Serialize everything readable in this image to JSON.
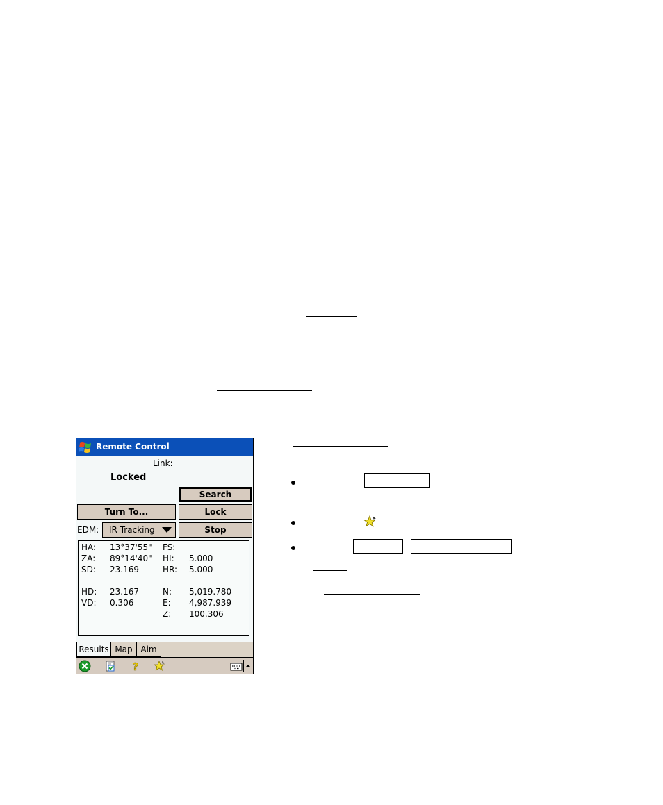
{
  "screen": {
    "title": "Remote Control",
    "link_label": "Link:",
    "status": "Locked",
    "buttons": {
      "search": "Search",
      "turn_to": "Turn To...",
      "lock": "Lock",
      "stop": "Stop"
    },
    "edm": {
      "label": "EDM:",
      "value": "IR Tracking"
    },
    "results": {
      "ha": {
        "label": "HA:",
        "value": "13°37'55\""
      },
      "za": {
        "label": "ZA:",
        "value": "89°14'40\""
      },
      "sd": {
        "label": "SD:",
        "value": "23.169"
      },
      "hd": {
        "label": "HD:",
        "value": "23.167"
      },
      "vd": {
        "label": "VD:",
        "value": "0.306"
      },
      "fs": {
        "label": "FS:",
        "value": ""
      },
      "hi": {
        "label": "HI:",
        "value": "5.000"
      },
      "hr": {
        "label": "HR:",
        "value": "5.000"
      },
      "n": {
        "label": "N:",
        "value": "5,019.780"
      },
      "e": {
        "label": "E:",
        "value": "4,987.939"
      },
      "z": {
        "label": "Z:",
        "value": "100.306"
      }
    },
    "tabs": [
      "Results",
      "Map",
      "Aim"
    ],
    "menubar_icons": [
      "close-icon",
      "checklist-icon",
      "help-icon",
      "favorites-star-icon",
      "keyboard-icon",
      "up-arrow-icon"
    ]
  },
  "colors": {
    "titlebar": "#0b50b8",
    "button_face": "#d7cbbf",
    "star": "#f2e12a"
  }
}
